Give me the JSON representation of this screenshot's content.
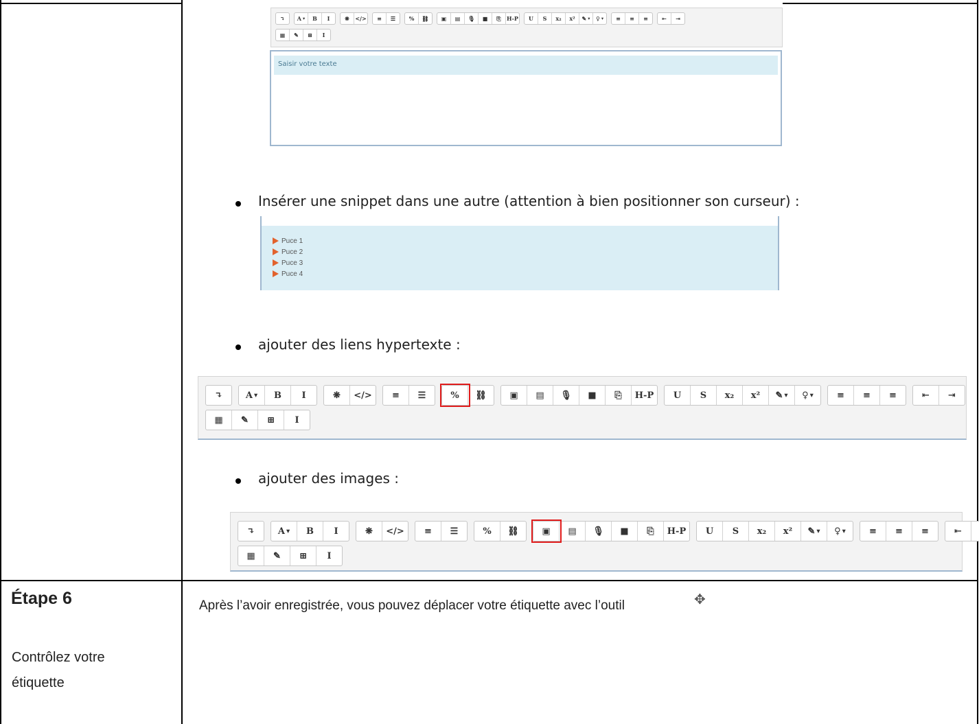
{
  "toolbar": {
    "row1": [
      [
        "↴"
      ],
      [
        "A",
        "B",
        "I"
      ],
      [
        "❋",
        "</>"
      ],
      [
        "≡",
        "☰"
      ],
      [
        "%",
        "⛓"
      ],
      [
        "▣",
        "▤",
        "🎙",
        "■",
        "⎘",
        "H-P"
      ],
      [
        "U",
        "S",
        "x₂",
        "x²",
        "✎",
        "♀"
      ],
      [
        "≡",
        "≡",
        "≡"
      ],
      [
        "⇤",
        "⇥"
      ]
    ],
    "row2": [
      [
        "▦",
        "✎",
        "⊞",
        "I"
      ]
    ]
  },
  "editor": {
    "placeholder_text": "Saisir votre texte"
  },
  "bullets": {
    "snippet": "Insérer une snippet dans une autre (attention à bien positionner son curseur) :",
    "links": "ajouter des liens hypertexte :",
    "images": "ajouter des images :"
  },
  "puces": [
    "Puce 1",
    "Puce 2",
    "Puce 3",
    "Puce 4"
  ],
  "step6": {
    "title": "Étape 6",
    "subtitle_line1": "Contrôlez votre",
    "subtitle_line2": "étiquette",
    "text": "Après l’avoir enregistrée, vous pouvez déplacer votre étiquette avec l’outil",
    "icon": "move-icon"
  }
}
